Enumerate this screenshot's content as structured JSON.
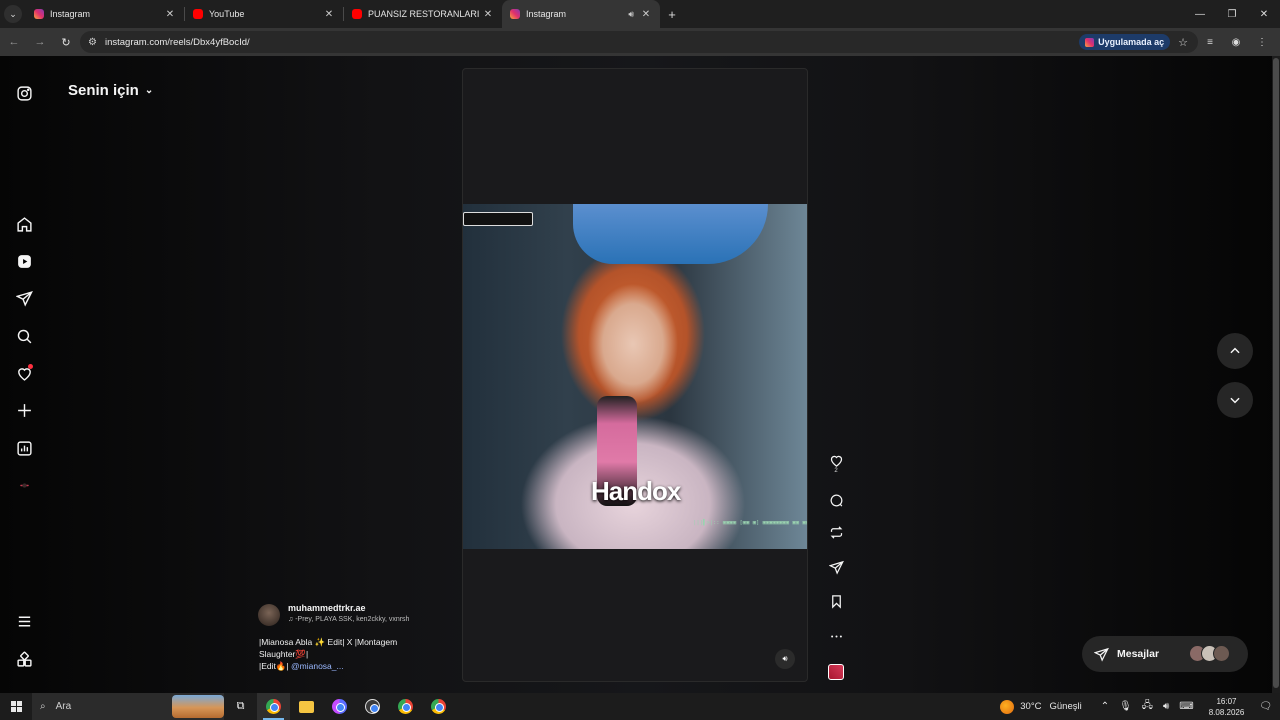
{
  "browser": {
    "tabs": [
      {
        "title": "Instagram",
        "favicon": "instagram-icon",
        "active": false
      },
      {
        "title": "YouTube",
        "favicon": "youtube-icon",
        "active": false
      },
      {
        "title": "PUANSIZ RESTORANLARI EMİR",
        "favicon": "youtube-icon",
        "active": false
      },
      {
        "title": "Instagram",
        "favicon": "instagram-icon",
        "active": true,
        "audio": true
      }
    ],
    "url": "instagram.com/reels/Dbx4yfBocId/",
    "open_app_label": "Uygulamada aç"
  },
  "instagram": {
    "feed_title": "Senin için",
    "sidebar_icons": [
      "instagram-logo-icon",
      "home-icon",
      "reels-icon",
      "direct-icon",
      "search-icon",
      "notifications-heart-icon",
      "create-plus-icon",
      "dashboard-icon",
      "profile-avatar-icon",
      "more-menu-icon",
      "also-from-meta-icon"
    ],
    "reel": {
      "overlay_text": "Handox",
      "ticker_text": "|||▌>|:: ▣▣▣▣ [▣▣ ▣] ▣▣▣▣▣▣▣▣ ▣▣ ▣▣",
      "author": "muhammedtrkr.ae",
      "audio": "-Prey, PLAYA SSK, ken2ckky, vxnrsh",
      "description_line1": "|Mianosa Abla ✨ Edit| X |Montagem",
      "description_line2": "Slaughter💯|",
      "description_line3": "|Edit🔥| ",
      "mention": "@mianosa_...",
      "like_count": "2"
    },
    "messages_label": "Mesajlar",
    "accent_notification": "#ff3040"
  },
  "taskbar": {
    "search_placeholder": "Ara",
    "weather": "30°C",
    "weather_desc": "Güneşli",
    "time": "16:07",
    "date": "8.08.2026"
  }
}
